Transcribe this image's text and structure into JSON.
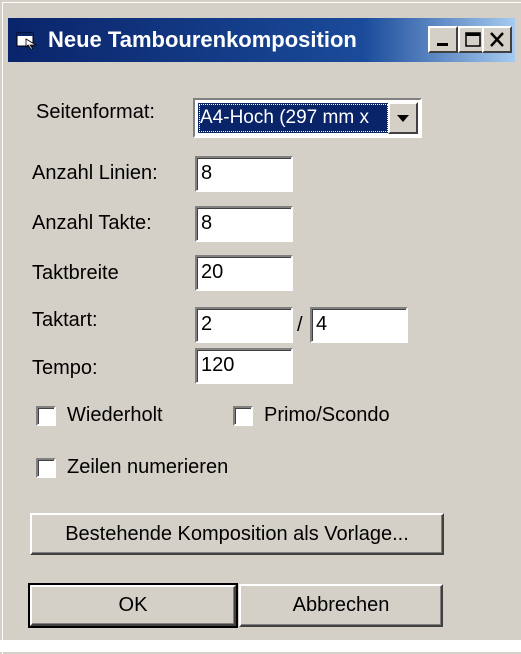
{
  "window": {
    "title": "Neue Tambourenkomposition"
  },
  "form": {
    "page_format_label": "Seitenformat:",
    "page_format_value": "A4-Hoch (297 mm x",
    "lines_label": "Anzahl Linien:",
    "lines_value": "8",
    "bars_label": "Anzahl Takte:",
    "bars_value": "8",
    "bar_width_label": "Taktbreite",
    "bar_width_value": "20",
    "time_sig_label": "Taktart:",
    "time_sig_numerator": "2",
    "time_sig_separator": "/",
    "time_sig_denominator": "4",
    "tempo_label": "Tempo:",
    "tempo_value": "120",
    "repeat_label": "Wiederholt",
    "repeat_checked": false,
    "primo_label": "Primo/Scondo",
    "primo_checked": false,
    "number_lines_label": "Zeilen numerieren",
    "number_lines_checked": false
  },
  "buttons": {
    "template_label": "Bestehende Komposition als Vorlage...",
    "ok_label": "OK",
    "cancel_label": "Abbrechen"
  },
  "icons": {
    "window_icon": "app-window-icon",
    "minimize": "minimize-icon",
    "maximize": "maximize-icon",
    "close": "close-icon",
    "dropdown": "chevron-down-icon"
  },
  "colors": {
    "titlebar_start": "#0a246a",
    "titlebar_end": "#a6caf0",
    "face": "#d4d0c8",
    "selection": "#0a246a"
  }
}
